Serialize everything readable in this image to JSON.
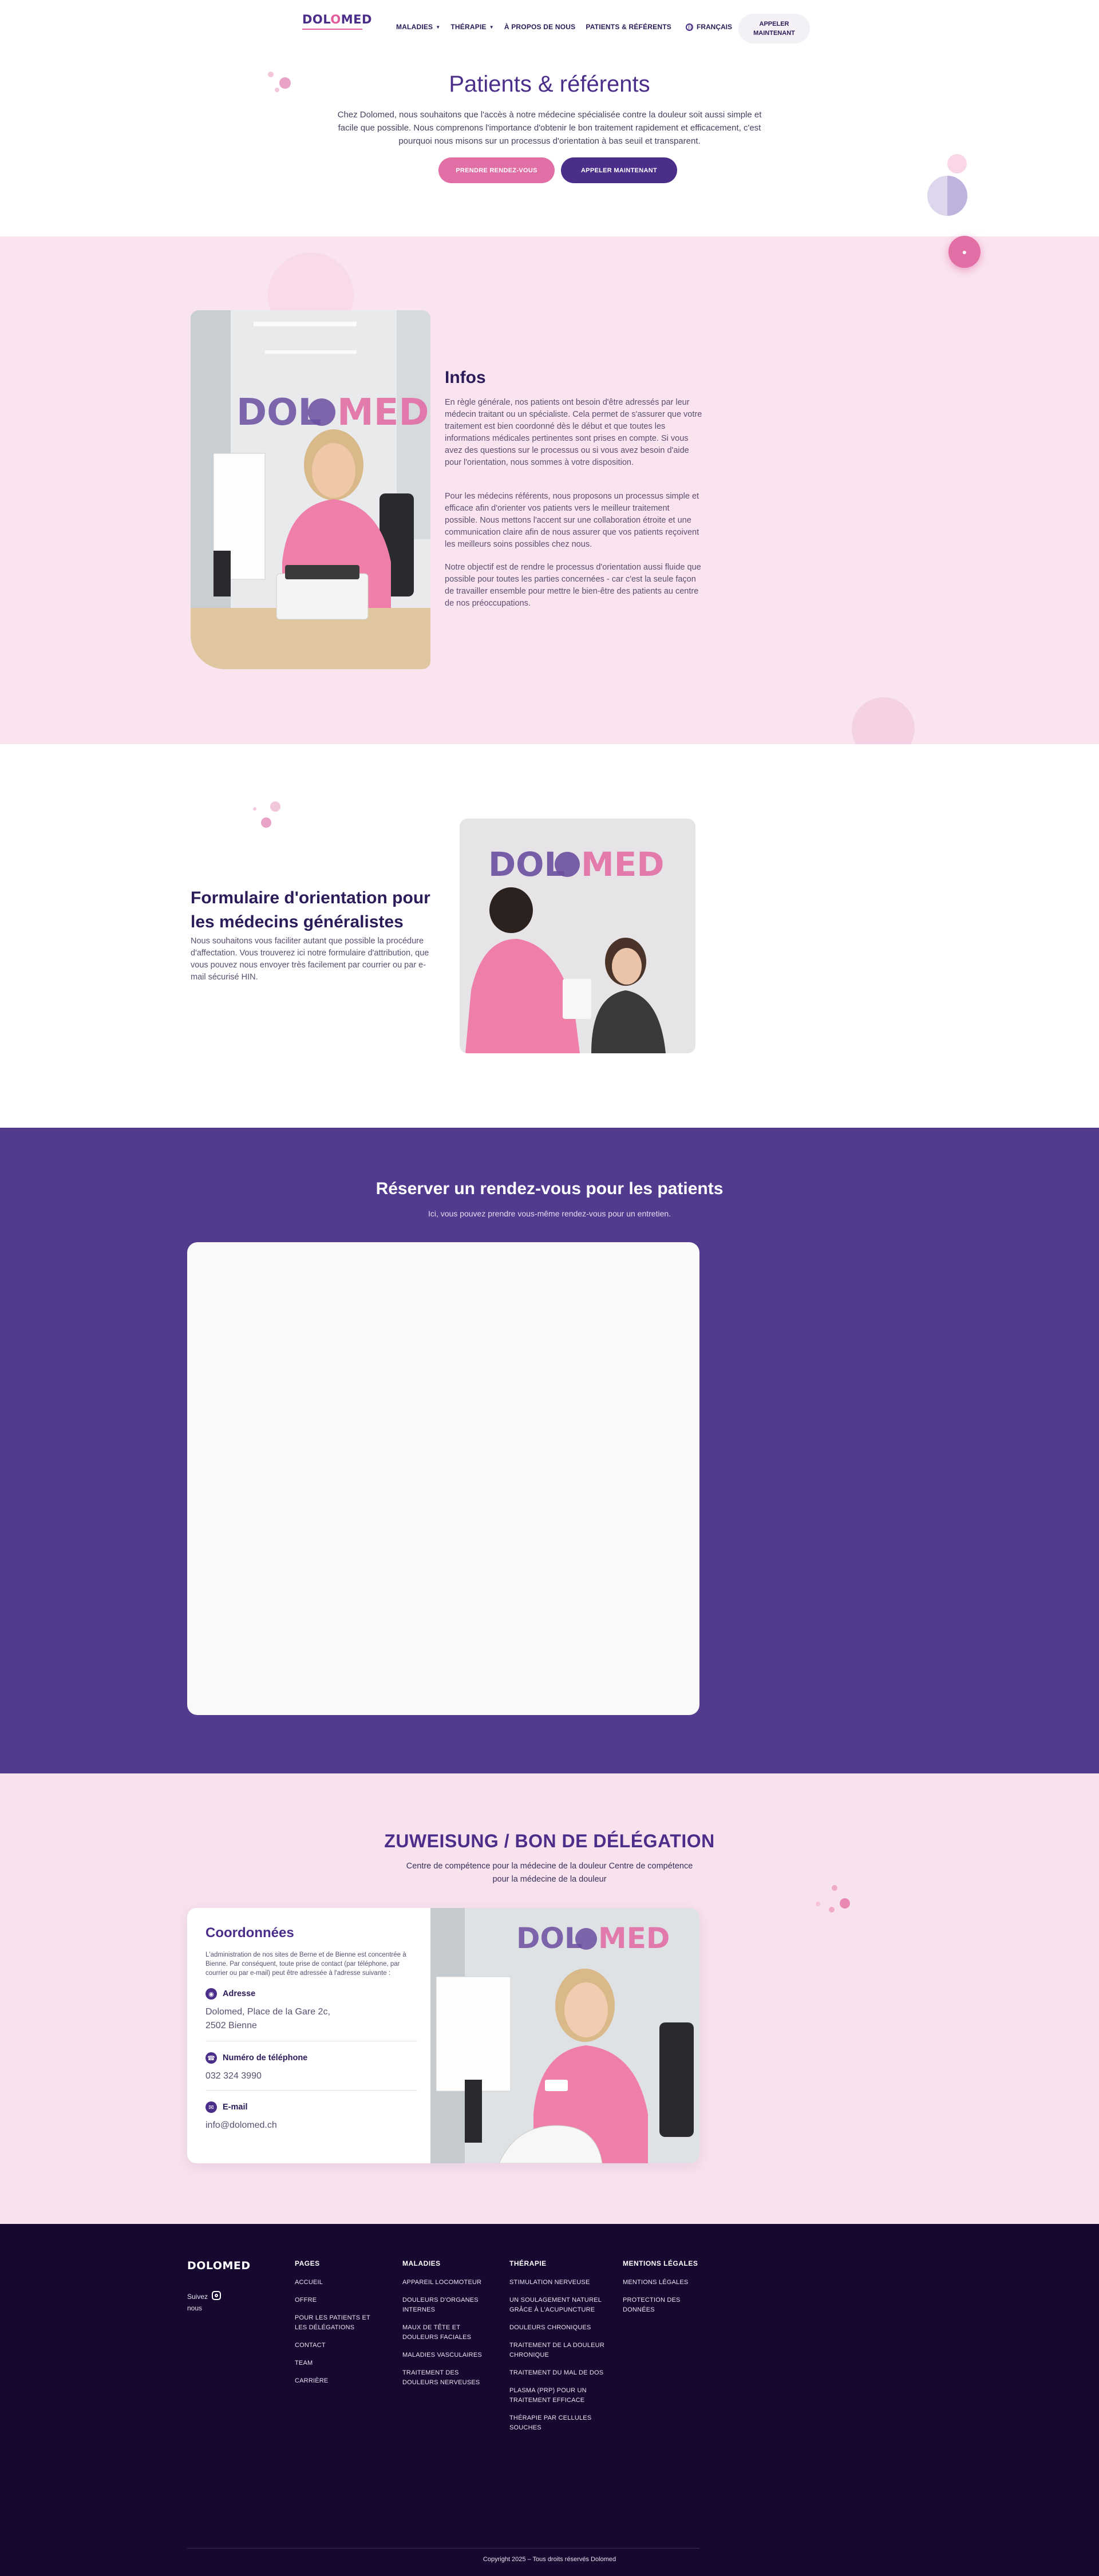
{
  "colors": {
    "brand_purple": "#4b2e8a",
    "brand_pink": "#e26ea6",
    "section_pink": "#fae4ef",
    "booking_bg": "#523b8f",
    "footer_bg": "#16082f"
  },
  "header": {
    "logo_text": "DOLOMED",
    "nav": [
      {
        "label": "MALADIES",
        "dropdown": true
      },
      {
        "label": "THÉRAPIE",
        "dropdown": true
      },
      {
        "label": "À PROPOS DE NOUS",
        "dropdown": false
      },
      {
        "label": "PATIENTS & RÉFÉRENTS",
        "dropdown": false
      }
    ],
    "language": "FRANÇAIS",
    "call_button": "APPELER MAINTENANT"
  },
  "hero": {
    "title": "Patients & référents",
    "text": "Chez Dolomed, nous souhaitons que l'accès à notre médecine spécialisée contre la douleur soit aussi simple et facile que possible. Nous comprenons l'importance d'obtenir le bon traitement rapidement et efficacement, c'est pourquoi nous misons sur un processus d'orientation à bas seuil et transparent.",
    "btn_appointment": "PRENDRE RENDEZ-VOUS",
    "btn_call": "APPELER MAINTENANT"
  },
  "infos": {
    "title": "Infos",
    "p1": "En règle générale, nos patients ont besoin d'être adressés par leur médecin traitant ou un spécialiste. Cela permet de s'assurer que votre traitement est bien coordonné dès le début et que toutes les informations médicales pertinentes sont prises en compte. Si vous avez des questions sur le processus ou si vous avez besoin d'aide pour l'orientation, nous sommes à votre disposition.",
    "p2": "Pour les médecins référents, nous proposons un processus simple et efficace afin d'orienter vos patients vers le meilleur traitement possible. Nous mettons l'accent sur une collaboration étroite et une communication claire afin de nous assurer que vos patients reçoivent les meilleurs soins possibles chez nous.",
    "p3": "Notre objectif est de rendre le processus d'orientation aussi fluide que possible pour toutes les parties concernées - car c'est la seule façon de travailler ensemble pour mettre le bien-être des patients au centre de nos préoccupations.",
    "img_logo": "DOLOMED"
  },
  "formular": {
    "title": "Formulaire d'orientation pour les médecins généralistes",
    "text": "Nous souhaitons vous faciliter autant que possible la procédure d'affectation. Vous trouverez ici notre formulaire d'attribution, que vous pouvez nous envoyer très facilement par courrier ou par e-mail sécurisé HIN.",
    "img_logo": "DOLOMED"
  },
  "booking": {
    "title": "Réserver un rendez-vous pour les patients",
    "subtitle": "Ici, vous pouvez prendre vous-même rendez-vous pour un entretien."
  },
  "zuweisung": {
    "title": "ZUWEISUNG / BON DE DÉLÉGATION",
    "subtitle": "Centre de compétence pour la médecine de la douleur Centre de compétence pour la médecine de la douleur",
    "contact": {
      "title": "Coordonnées",
      "intro": "L'administration de nos sites de Berne et de Bienne est concentrée à Bienne. Par conséquent, toute prise de contact (par téléphone, par courrier ou par e-mail) peut être adressée à l'adresse suivante :",
      "address_label": "Adresse",
      "address_line1": "Dolomed, Place de la Gare 2c,",
      "address_line2": "2502 Bienne",
      "phone_label": "Numéro de téléphone",
      "phone": "032 324 3990",
      "email_label": "E-mail",
      "email": "info@dolomed.ch"
    },
    "img_logo": "DOLOMED"
  },
  "footer": {
    "logo": "DOLOMED",
    "follow": "Suivez nous",
    "columns": [
      {
        "title": "PAGES",
        "links": [
          "ACCUEIL",
          "OFFRE",
          "POUR LES PATIENTS ET LES DÉLÉGATIONS",
          "CONTACT",
          "TEAM",
          "CARRIÈRE"
        ]
      },
      {
        "title": "MALADIES",
        "links": [
          "APPAREIL LOCOMOTEUR",
          "DOULEURS D'ORGANES INTERNES",
          "MAUX DE TÊTE ET DOULEURS FACIALES",
          "MALADIES VASCULAIRES",
          "TRAITEMENT DES DOULEURS NERVEUSES"
        ]
      },
      {
        "title": "THÉRAPIE",
        "links": [
          "STIMULATION NERVEUSE",
          "UN SOULAGEMENT NATUREL GRÂCE À L'ACUPUNCTURE",
          "DOULEURS CHRONIQUES",
          "TRAITEMENT DE LA DOULEUR CHRONIQUE",
          "TRAITEMENT DU MAL DE DOS",
          "PLASMA (PRP) POUR UN TRAITEMENT EFFICACE",
          "THÉRAPIE PAR CELLULES SOUCHES"
        ]
      },
      {
        "title": "MENTIONS LÉGALES",
        "links": [
          "MENTIONS LÉGALES",
          "PROTECTION DES DONNÉES"
        ]
      }
    ],
    "copyright": "Copyright 2025 – Tous droits réservés Dolomed"
  }
}
